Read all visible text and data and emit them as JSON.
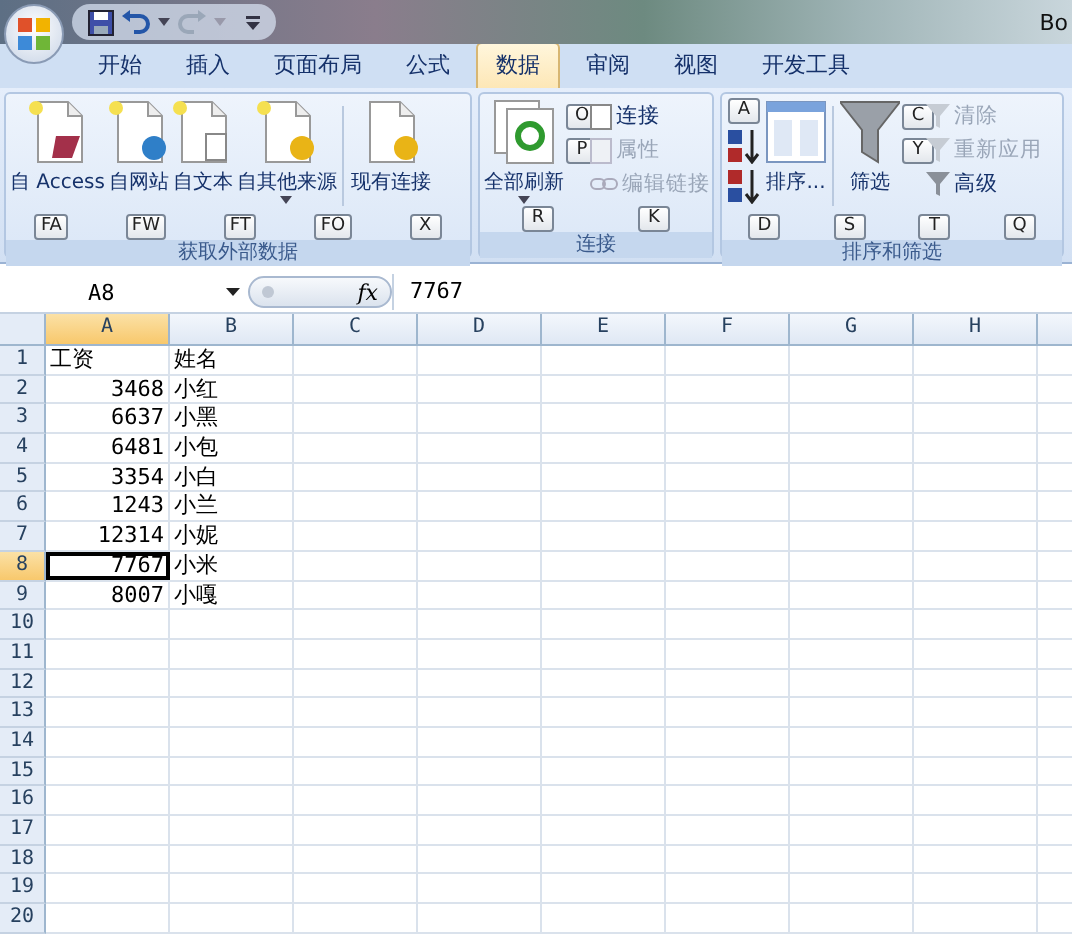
{
  "title_bar": {
    "title": "Bo"
  },
  "tabs": [
    {
      "label": "开始",
      "selected": false
    },
    {
      "label": "插入",
      "selected": false
    },
    {
      "label": "页面布局",
      "selected": false
    },
    {
      "label": "公式",
      "selected": false
    },
    {
      "label": "数据",
      "selected": true
    },
    {
      "label": "审阅",
      "selected": false
    },
    {
      "label": "视图",
      "selected": false
    },
    {
      "label": "开发工具",
      "selected": false
    }
  ],
  "ribbon_groups": [
    {
      "label": "获取外部数据",
      "keytips": [
        "FA",
        "FW",
        "FT",
        "FO",
        "X"
      ],
      "items": [
        {
          "kind": "large",
          "label": "自 Access",
          "dropdown": false,
          "disabled": false
        },
        {
          "kind": "large",
          "label": "自网站",
          "dropdown": false,
          "disabled": false
        },
        {
          "kind": "large",
          "label": "自文本",
          "dropdown": false,
          "disabled": false
        },
        {
          "kind": "large",
          "label": "自其他来源",
          "dropdown": true,
          "disabled": false
        },
        {
          "kind": "separator"
        },
        {
          "kind": "large",
          "label": "现有连接",
          "dropdown": false,
          "disabled": false
        }
      ]
    },
    {
      "label": "连接",
      "keytips": [
        "R",
        "K"
      ],
      "items": [
        {
          "kind": "large",
          "label": "全部刷新",
          "dropdown": true,
          "disabled": false
        },
        {
          "kind": "stack",
          "entries": [
            {
              "label": "连接",
              "disabled": false,
              "keytip": "O"
            },
            {
              "label": "属性",
              "disabled": true,
              "keytip": "P"
            },
            {
              "label": "编辑链接",
              "disabled": true
            }
          ]
        }
      ]
    },
    {
      "label": "排序和筛选",
      "keytips": [
        "D",
        "S",
        "T",
        "Q"
      ],
      "items": [
        {
          "kind": "sortpair",
          "keytip": "A"
        },
        {
          "kind": "large",
          "label": "排序...",
          "dropdown": false,
          "disabled": false
        },
        {
          "kind": "separator"
        },
        {
          "kind": "large",
          "label": "筛选",
          "dropdown": false,
          "disabled": false
        },
        {
          "kind": "stack",
          "entries": [
            {
              "label": "清除",
              "disabled": true,
              "keytip": "C"
            },
            {
              "label": "重新应用",
              "disabled": true,
              "keytip": "Y"
            },
            {
              "label": "高级",
              "disabled": false
            }
          ]
        }
      ]
    }
  ],
  "formula_bar": {
    "name_box": "A8",
    "fx": "fx",
    "formula": "7767"
  },
  "columns": [
    {
      "label": "A",
      "selected": true
    },
    {
      "label": "B",
      "selected": false
    },
    {
      "label": "C",
      "selected": false
    },
    {
      "label": "D",
      "selected": false
    },
    {
      "label": "E",
      "selected": false
    },
    {
      "label": "F",
      "selected": false
    },
    {
      "label": "G",
      "selected": false
    },
    {
      "label": "H",
      "selected": false
    }
  ],
  "rows": [
    {
      "label": "1",
      "selected": false,
      "cells": [
        "工资",
        "姓名"
      ]
    },
    {
      "label": "2",
      "selected": false,
      "cells": [
        "3468",
        "小红"
      ]
    },
    {
      "label": "3",
      "selected": false,
      "cells": [
        "6637",
        "小黑"
      ]
    },
    {
      "label": "4",
      "selected": false,
      "cells": [
        "6481",
        "小包"
      ]
    },
    {
      "label": "5",
      "selected": false,
      "cells": [
        "3354",
        "小白"
      ]
    },
    {
      "label": "6",
      "selected": false,
      "cells": [
        "1243",
        "小兰"
      ]
    },
    {
      "label": "7",
      "selected": false,
      "cells": [
        "12314",
        "小妮"
      ]
    },
    {
      "label": "8",
      "selected": true,
      "cells": [
        "7767",
        "小米"
      ]
    },
    {
      "label": "9",
      "selected": false,
      "cells": [
        "8007",
        "小嘎"
      ]
    },
    {
      "label": "10",
      "selected": false,
      "cells": []
    },
    {
      "label": "11",
      "selected": false,
      "cells": []
    },
    {
      "label": "12",
      "selected": false,
      "cells": []
    },
    {
      "label": "13",
      "selected": false,
      "cells": []
    },
    {
      "label": "14",
      "selected": false,
      "cells": []
    },
    {
      "label": "15",
      "selected": false,
      "cells": []
    },
    {
      "label": "16",
      "selected": false,
      "cells": []
    },
    {
      "label": "17",
      "selected": false,
      "cells": []
    },
    {
      "label": "18",
      "selected": false,
      "cells": []
    },
    {
      "label": "19",
      "selected": false,
      "cells": []
    },
    {
      "label": "20",
      "selected": false,
      "cells": []
    }
  ]
}
